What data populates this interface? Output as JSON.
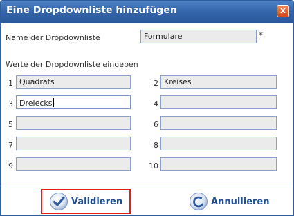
{
  "dialog": {
    "title": "Eine Dropdownliste hinzufügen",
    "close_label": "x"
  },
  "name_label": "Name der Dropdownliste",
  "name_value": "Formulare",
  "required_mark": "*",
  "values_section_label": "Werte der Dropdownliste eingeben",
  "entries": [
    {
      "num": "1",
      "value": ""
    },
    {
      "num": "2",
      "value": ""
    },
    {
      "num": "3",
      "value": ""
    },
    {
      "num": "4",
      "value": ""
    },
    {
      "num": "5",
      "value": ""
    },
    {
      "num": "6",
      "value": ""
    },
    {
      "num": "7",
      "value": ""
    },
    {
      "num": "8",
      "value": ""
    },
    {
      "num": "9",
      "value": ""
    },
    {
      "num": "10",
      "value": ""
    }
  ],
  "entry_values": {
    "1": "Quadrats",
    "2": "Kreises",
    "3": "Drelecks"
  },
  "buttons": {
    "validate": "Validieren",
    "cancel": "Annullieren"
  },
  "colors": {
    "titlebar": "#3465ab",
    "highlight_border": "#e0201d",
    "button_text": "#1f4f94"
  }
}
